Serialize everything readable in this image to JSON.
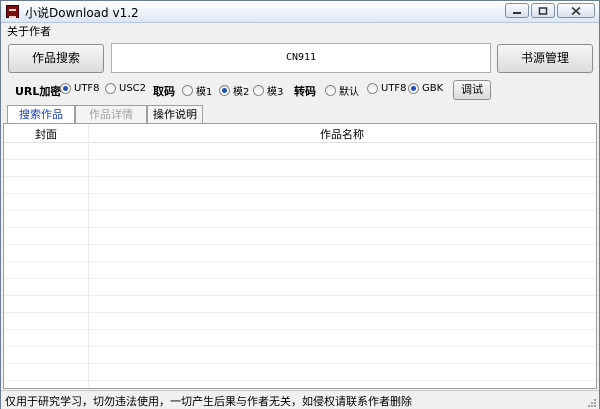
{
  "window": {
    "title": "小说Download v1.2",
    "controls": {
      "minimize": "minimize-icon",
      "maximize": "maximize-icon",
      "close": "close-icon"
    }
  },
  "menu": {
    "about": "关于作者"
  },
  "toolbar": {
    "search_button": "作品搜索",
    "search_value": "CN911",
    "source_button": "书源管理"
  },
  "options": {
    "url_encode": {
      "label": "URL加密",
      "choices": [
        "UTF8",
        "USC2"
      ],
      "selected": "UTF8"
    },
    "fetch": {
      "label": "取码",
      "choices": [
        "模1",
        "模2",
        "模3"
      ],
      "selected": "模2"
    },
    "convert": {
      "label": "转码",
      "choices": [
        "默认",
        "UTF8",
        "GBK"
      ],
      "selected": "GBK"
    },
    "debug_button": "调试"
  },
  "tabs": [
    {
      "label": "搜索作品",
      "state": "active"
    },
    {
      "label": "作品详情",
      "state": "disabled"
    },
    {
      "label": "操作说明",
      "state": "normal"
    }
  ],
  "table": {
    "columns": [
      "封面",
      "作品名称"
    ],
    "rows": []
  },
  "status": {
    "text": "仅用于研究学习，切勿违法使用，一切产生后果与作者无关，如侵权请联系作者删除"
  },
  "colors": {
    "accent": "#1a3fb0",
    "titlebar": "#dce7f4",
    "window_bg": "#f0f0f0"
  }
}
